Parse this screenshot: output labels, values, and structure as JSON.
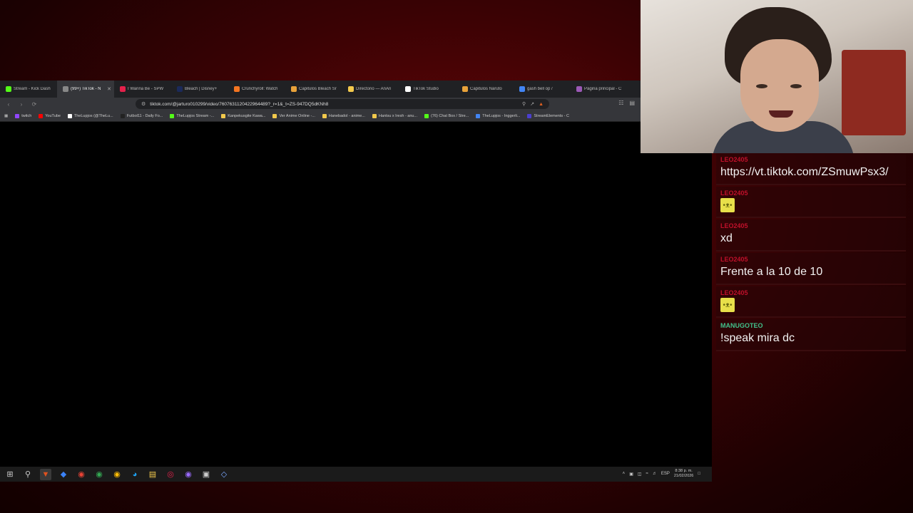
{
  "browser": {
    "tabs": [
      {
        "label": "Stream - Kick Dash",
        "color": "#53fc18",
        "active": false
      },
      {
        "label": "(99+) TikTok - N",
        "color": "#888888",
        "active": true
      },
      {
        "label": "I Wanna Be - SPW",
        "color": "#e3214b",
        "active": false
      },
      {
        "label": "Bleach | Disney+",
        "color": "#1b2a5a",
        "active": false
      },
      {
        "label": "Crunchyroll: Watch",
        "color": "#f47521",
        "active": false
      },
      {
        "label": "Capitulos Bleach Sr",
        "color": "#e8a23a",
        "active": false
      },
      {
        "label": "Directorio — AnAn",
        "color": "#f2c94c",
        "active": false
      },
      {
        "label": "TikTok Studio",
        "color": "#ffffff",
        "active": false
      },
      {
        "label": "Capitulos Naruto",
        "color": "#e8a23a",
        "active": false
      },
      {
        "label": "gash bell op /",
        "color": "#4285f4",
        "active": false
      },
      {
        "label": "Página principal - C",
        "color": "#9b59b6",
        "active": false
      }
    ],
    "url": "tiktok.com/@jarturo010299/video/7607631120422964489?_r=1&_t=ZS-947DQ5dKNh8",
    "bookmarks": [
      {
        "label": "twitch",
        "color": "#9146ff"
      },
      {
        "label": "YouTube",
        "color": "#ff0000"
      },
      {
        "label": "TheLupjos (@TheLu...",
        "color": "#ffffff"
      },
      {
        "label": "Futbol11 - Daily Fo...",
        "color": "#222222"
      },
      {
        "label": "TheLupjos Stream -...",
        "color": "#53fc18"
      },
      {
        "label": "Kanpekusgite Kawa...",
        "color": "#f2c94c"
      },
      {
        "label": "Ver Anime Online -...",
        "color": "#f2c94c"
      },
      {
        "label": "Hanebadol - anime...",
        "color": "#f2c94c"
      },
      {
        "label": "Hantsu x Iresh - anu...",
        "color": "#f2c94c"
      },
      {
        "label": "(76) Chat Box / Stre...",
        "color": "#53fc18"
      },
      {
        "label": "TheLupjos - Inggerli...",
        "color": "#4285f4"
      },
      {
        "label": "StreamElements - C",
        "color": "#4b3fcf"
      }
    ]
  },
  "taskbar": {
    "lang": "ESP",
    "time": "8:38 p. m.",
    "date": "21/02/2026"
  },
  "chat": {
    "messages": [
      {
        "user": "LEO2405",
        "text": "https://vt.tiktok.com/ZSmuwPsx3/",
        "emote": false,
        "user_color": "red"
      },
      {
        "user": "LEO2405",
        "text": "",
        "emote": true,
        "user_color": "red"
      },
      {
        "user": "LEO2405",
        "text": "xd",
        "emote": false,
        "user_color": "red"
      },
      {
        "user": "LEO2405",
        "text": "Frente a la 10 de 10",
        "emote": false,
        "user_color": "red"
      },
      {
        "user": "LEO2405",
        "text": "",
        "emote": true,
        "user_color": "red"
      },
      {
        "user": "MANUGOTEO",
        "text": "!speak mira dc",
        "emote": false,
        "user_color": "green"
      }
    ]
  }
}
